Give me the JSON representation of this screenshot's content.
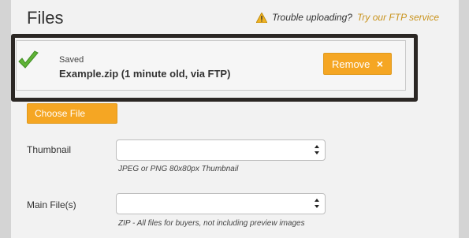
{
  "header": {
    "title": "Files",
    "trouble_text": "Trouble uploading?",
    "ftp_link": "Try our FTP service"
  },
  "saved": {
    "status": "Saved",
    "file": "Example.zip (1 minute old, via FTP)",
    "remove_label": "Remove",
    "remove_icon": "×"
  },
  "choose_file_label": "Choose File",
  "fields": {
    "thumbnail": {
      "label": "Thumbnail",
      "value": "",
      "hint": "JPEG or PNG 80x80px Thumbnail"
    },
    "main_files": {
      "label": "Main File(s)",
      "value": "",
      "hint": "ZIP - All files for buyers, not including preview images"
    }
  },
  "colors": {
    "accent": "#f5a623",
    "link": "#c9931c",
    "highlight_border": "#2b2724",
    "check": "#5fb336"
  }
}
